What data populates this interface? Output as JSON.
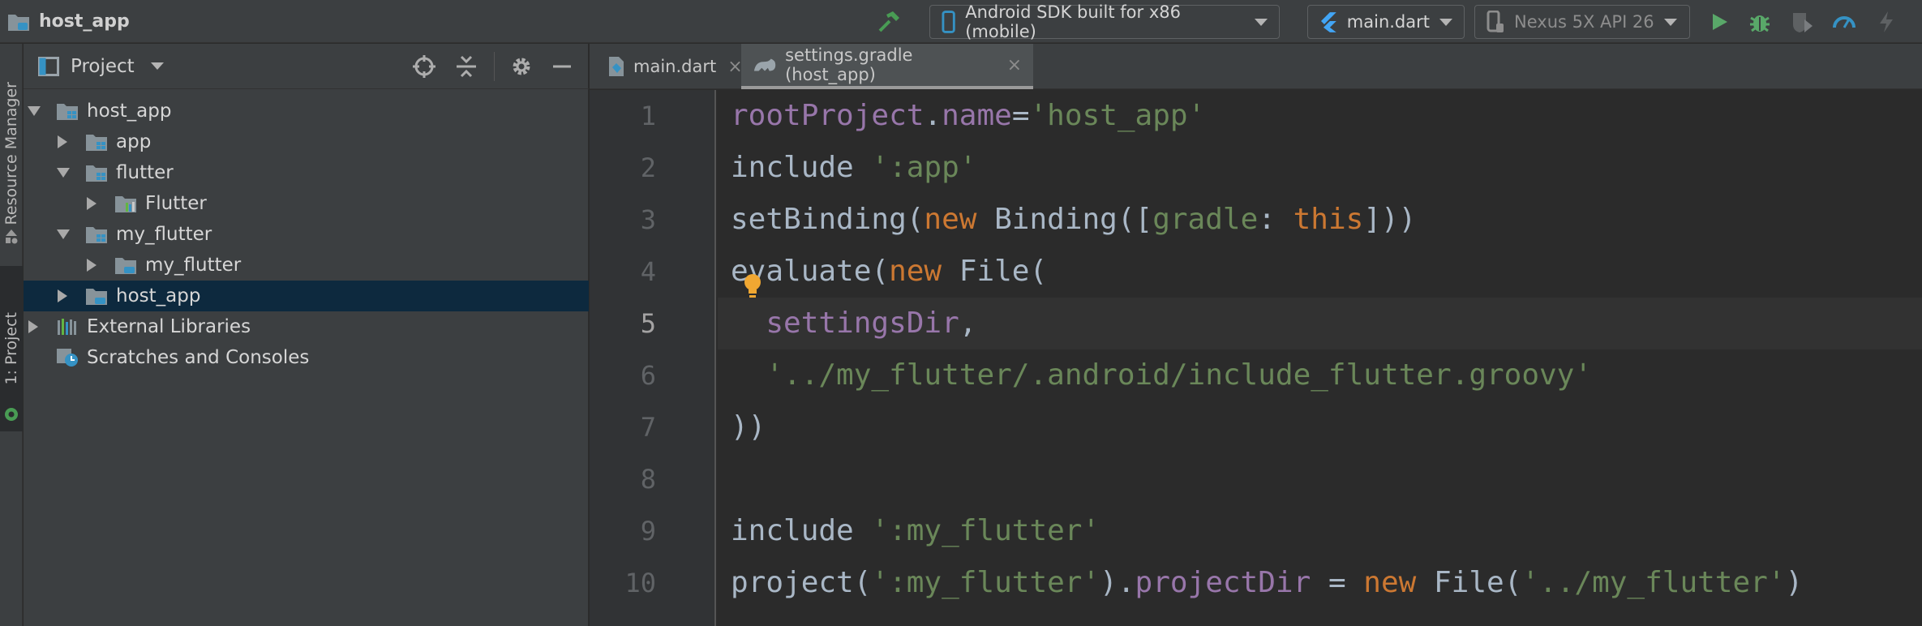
{
  "window": {
    "project_name": "host_app",
    "colors": {
      "accent_green": "#499c54",
      "run_green": "#59a869",
      "flutter_blue": "#42a5f5",
      "selection": "#0d293e"
    }
  },
  "toolbar": {
    "device_selector": "Android SDK built for x86 (mobile)",
    "run_config": "main.dart",
    "avd_selector": "Nexus 5X API 26",
    "icons": [
      "hammer-icon",
      "run-icon",
      "debug-icon",
      "coverage-icon",
      "profile-icon",
      "apply-changes-icon"
    ]
  },
  "side_tabs": {
    "resource_manager": "Resource Manager",
    "project": "1: Project"
  },
  "project_panel": {
    "title": "Project",
    "tree": [
      {
        "label": "host_app",
        "depth": 0,
        "state": "expanded",
        "icon": "module-folder-icon"
      },
      {
        "label": "app",
        "depth": 1,
        "state": "collapsed",
        "icon": "module-folder-icon"
      },
      {
        "label": "flutter",
        "depth": 1,
        "state": "expanded",
        "icon": "module-folder-icon"
      },
      {
        "label": "Flutter",
        "depth": 2,
        "state": "collapsed",
        "icon": "library-folder-icon"
      },
      {
        "label": "my_flutter",
        "depth": 1,
        "state": "expanded",
        "icon": "module-folder-icon"
      },
      {
        "label": "my_flutter",
        "depth": 2,
        "state": "collapsed",
        "icon": "flutter-folder-icon"
      },
      {
        "label": "host_app",
        "depth": 1,
        "state": "collapsed",
        "icon": "project-folder-icon",
        "selected": true
      },
      {
        "label": "External Libraries",
        "depth": 0,
        "state": "collapsed",
        "icon": "libraries-icon"
      },
      {
        "label": "Scratches and Consoles",
        "depth": 0,
        "state": "leaf",
        "icon": "scratches-icon"
      }
    ]
  },
  "editor": {
    "tabs": [
      {
        "label": "main.dart",
        "active": false
      },
      {
        "label": "settings.gradle (host_app)",
        "active": true
      }
    ],
    "line_numbers": [
      "1",
      "2",
      "3",
      "4",
      "5",
      "6",
      "7",
      "8",
      "9",
      "10"
    ],
    "current_line": 5,
    "lines": [
      [
        [
          "prop",
          "rootProject"
        ],
        [
          "plain",
          "."
        ],
        [
          "prop",
          "name"
        ],
        [
          "plain",
          "="
        ],
        [
          "str",
          "'host_app'"
        ]
      ],
      [
        [
          "plain",
          "include "
        ],
        [
          "str",
          "':app'"
        ]
      ],
      [
        [
          "plain",
          "setBinding("
        ],
        [
          "kw",
          "new "
        ],
        [
          "plain",
          "Binding(["
        ],
        [
          "str",
          "gradle"
        ],
        [
          "plain",
          ": "
        ],
        [
          "kw",
          "this"
        ],
        [
          "plain",
          "]))"
        ]
      ],
      [
        [
          "plain",
          "evaluate("
        ],
        [
          "kw",
          "new "
        ],
        [
          "plain",
          "File("
        ]
      ],
      [
        [
          "plain",
          "  "
        ],
        [
          "prop",
          "settingsDir"
        ],
        [
          "plain",
          ","
        ]
      ],
      [
        [
          "plain",
          "  "
        ],
        [
          "str",
          "'../my_flutter/.android/include_flutter.groovy'"
        ]
      ],
      [
        [
          "plain",
          "))"
        ]
      ],
      [],
      [
        [
          "plain",
          "include "
        ],
        [
          "str",
          "':my_flutter'"
        ]
      ],
      [
        [
          "plain",
          "project("
        ],
        [
          "str",
          "':my_flutter'"
        ],
        [
          "plain",
          ")."
        ],
        [
          "prop",
          "projectDir"
        ],
        [
          "plain",
          " = "
        ],
        [
          "kw",
          "new "
        ],
        [
          "plain",
          "File("
        ],
        [
          "str",
          "'../my_flutter'"
        ],
        [
          "plain",
          ")"
        ]
      ]
    ]
  }
}
